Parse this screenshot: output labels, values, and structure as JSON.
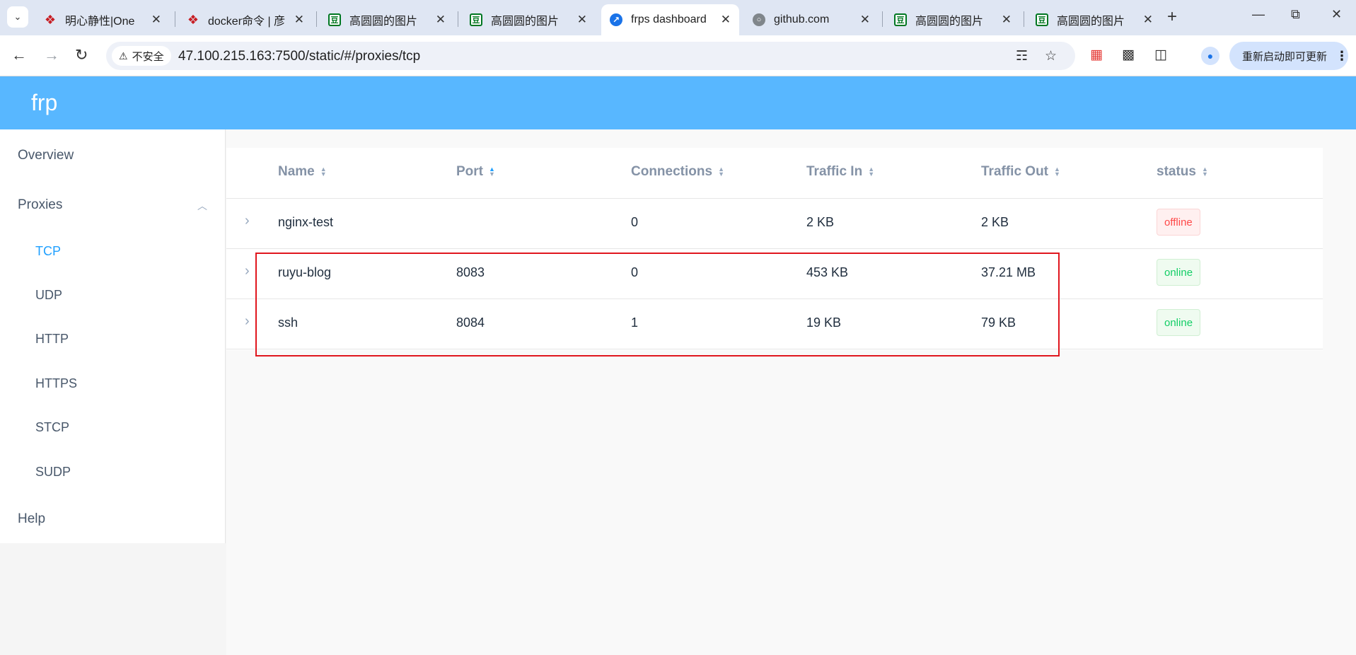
{
  "browser": {
    "tabs": [
      {
        "title": "明心静性|One",
        "favicon": "gitee-icon",
        "active": false
      },
      {
        "title": "docker命令 | 彦",
        "favicon": "gitee-icon",
        "active": false
      },
      {
        "title": "高圆圆的图片",
        "favicon": "douban-icon",
        "active": false
      },
      {
        "title": "高圆圆的图片",
        "favicon": "douban-icon",
        "active": false
      },
      {
        "title": "frps dashboard",
        "favicon": "frp-icon",
        "active": true
      },
      {
        "title": "github.com",
        "favicon": "globe-icon",
        "active": false
      },
      {
        "title": "高圆圆的图片",
        "favicon": "douban-icon",
        "active": false
      },
      {
        "title": "高圆圆的图片",
        "favicon": "douban-icon",
        "active": false
      }
    ],
    "security_label": "不安全",
    "url": "47.100.215.163:7500/static/#/proxies/tcp",
    "update_label": "重新启动即可更新"
  },
  "app": {
    "title": "frp",
    "menu": {
      "overview": "Overview",
      "proxies": "Proxies",
      "sub": [
        "TCP",
        "UDP",
        "HTTP",
        "HTTPS",
        "STCP",
        "SUDP"
      ],
      "active_sub": "TCP",
      "help": "Help"
    },
    "table": {
      "columns": [
        "Name",
        "Port",
        "Connections",
        "Traffic In",
        "Traffic Out",
        "status"
      ],
      "sorted_column": "Port",
      "rows": [
        {
          "name": "nginx-test",
          "port": "",
          "connections": "0",
          "traffic_in": "2 KB",
          "traffic_out": "2 KB",
          "status": "offline"
        },
        {
          "name": "ruyu-blog",
          "port": "8083",
          "connections": "0",
          "traffic_in": "453 KB",
          "traffic_out": "37.21 MB",
          "status": "online"
        },
        {
          "name": "ssh",
          "port": "8084",
          "connections": "1",
          "traffic_in": "19 KB",
          "traffic_out": "79 KB",
          "status": "online"
        }
      ]
    },
    "colors": {
      "header": "#58b7ff",
      "accent": "#20a0ff",
      "offline": "#ff4949",
      "online": "#13ce66",
      "highlight_box": "#e0161e"
    }
  }
}
